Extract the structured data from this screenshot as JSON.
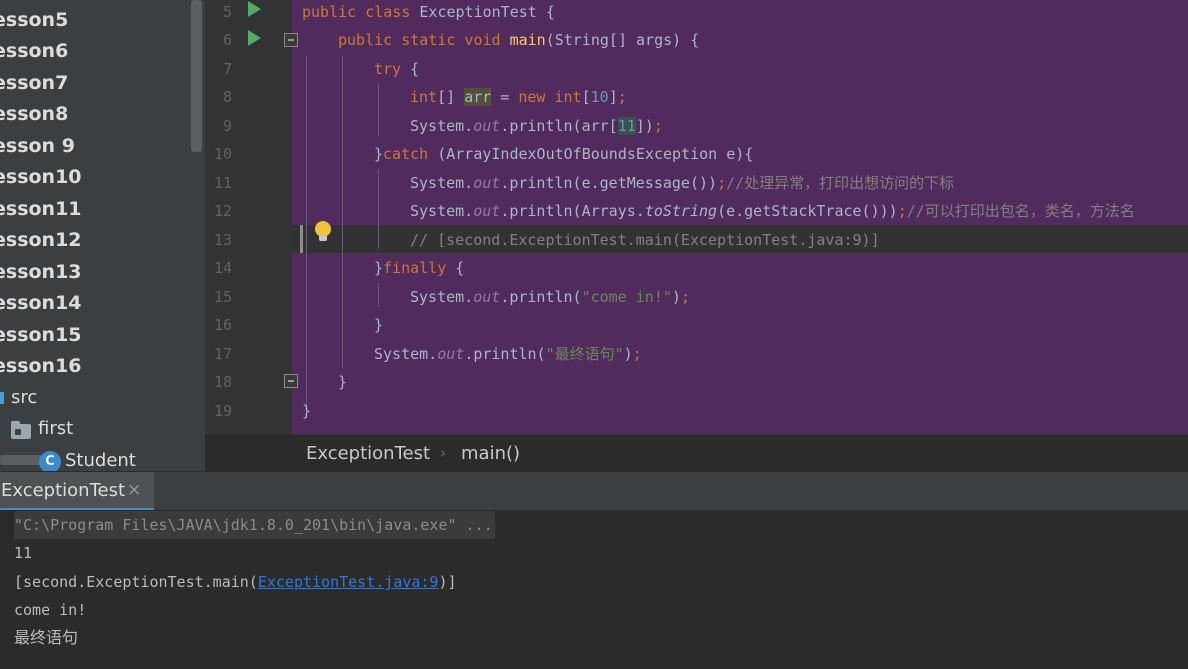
{
  "sidebar": {
    "lessons": [
      {
        "prefix": "",
        "label": "esson5"
      },
      {
        "prefix": "",
        "label": "esson6"
      },
      {
        "prefix": "",
        "label": "esson7"
      },
      {
        "prefix": "",
        "label": "esson8"
      },
      {
        "prefix": "",
        "label": "esson 9"
      },
      {
        "prefix": "",
        "label": "esson10"
      },
      {
        "prefix": "",
        "label": "esson11"
      },
      {
        "prefix": "",
        "label": "esson12"
      },
      {
        "prefix": "",
        "label": "esson13"
      },
      {
        "prefix": "",
        "label": "esson14"
      },
      {
        "prefix": "",
        "label": "esson15"
      },
      {
        "prefix": "",
        "label": "esson16"
      }
    ],
    "src_label": "src",
    "first_label": "first",
    "student_label": "Student",
    "class_icon_letter": "C"
  },
  "editor": {
    "line_numbers": [
      "5",
      "6",
      "7",
      "8",
      "9",
      "10",
      "11",
      "12",
      "13",
      "14",
      "15",
      "16",
      "17",
      "18",
      "19"
    ],
    "code": {
      "l5_kw1": "public",
      "l5_kw2": "class",
      "l5_name": "ExceptionTest",
      "l5_brace": "{",
      "l6_kw": "public static void",
      "l6_fn": "main",
      "l6_rest": "(String[] args) {",
      "l7_kw": "try",
      "l7_rest": " {",
      "l8_kw": "int",
      "l8_br": "[] ",
      "l8_var": "arr",
      "l8_eq": " = ",
      "l8_new": "new",
      "l8_int": "int",
      "l8_open": "[",
      "l8_num": "10",
      "l8_close": "]",
      "l8_semi": ";",
      "l9_a": "System.",
      "l9_out": "out",
      "l9_b": ".println(arr[",
      "l9_num": "11",
      "l9_c": "])",
      "l9_semi": ";",
      "l10_a": "}",
      "l10_kw": "catch",
      "l10_b": " (ArrayIndexOutOfBoundsException e){",
      "l11_a": "System.",
      "l11_out": "out",
      "l11_b": ".println(e.getMessage())",
      "l11_semi": ";",
      "l11_cm": "//处理异常，打印出想访问的下标",
      "l12_a": "System.",
      "l12_out": "out",
      "l12_b": ".println(Arrays.",
      "l12_fn": "toString",
      "l12_c": "(e.getStackTrace()))",
      "l12_semi": ";",
      "l12_cm": "//可以打印出包名，类名，方法名",
      "l13_cm": "// [second.ExceptionTest.main(ExceptionTest.java:9)]",
      "l14_a": "}",
      "l14_kw": "finally",
      "l14_b": " {",
      "l15_a": "System.",
      "l15_out": "out",
      "l15_b": ".println(",
      "l15_str": "\"come in!\"",
      "l15_c": ")",
      "l15_semi": ";",
      "l16": "}",
      "l17_a": "System.",
      "l17_out": "out",
      "l17_b": ".println(",
      "l17_str": "\"最终语句\"",
      "l17_c": ")",
      "l17_semi": ";",
      "l18": "}",
      "l19": "}"
    }
  },
  "breadcrumb": {
    "class": "ExceptionTest",
    "separator": "›",
    "method": "main()"
  },
  "run_panel": {
    "tab_label": "ExceptionTest",
    "tab_close": "×",
    "console": {
      "cmd": "\"C:\\Program Files\\JAVA\\jdk1.8.0_201\\bin\\java.exe\" ...",
      "out1": "11",
      "out2_a": "[second.ExceptionTest.main(",
      "out2_link": "ExceptionTest.java:9",
      "out2_b": ")]",
      "out3": "come in!",
      "out4": "最终语句"
    }
  },
  "colors": {
    "editor_bg": "#522b5e",
    "caret_line": "#323232",
    "keyword": "#cc7832",
    "method": "#ffc66d",
    "field": "#9876aa",
    "number": "#6897bb",
    "string": "#6a8759",
    "comment": "#808080",
    "link": "#287bde"
  }
}
